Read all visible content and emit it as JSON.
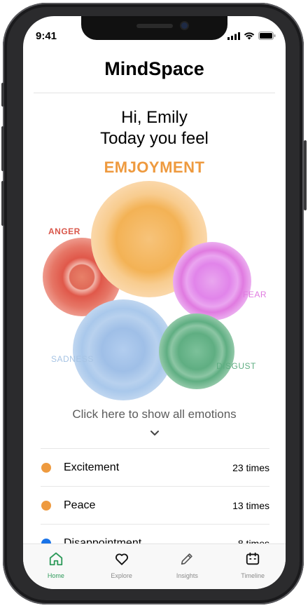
{
  "status": {
    "time": "9:41"
  },
  "app": {
    "title": "MindSpace"
  },
  "greeting": {
    "line1": "Hi, Emily",
    "line2": "Today you feel"
  },
  "today_emotion": "EMJOYMENT",
  "emotions": {
    "anger": {
      "label": "ANGER",
      "color": "#e0584a"
    },
    "fear": {
      "label": "FEAR",
      "color": "#e07ae0"
    },
    "sadness": {
      "label": "SADNESS",
      "color": "#9cc2e8"
    },
    "disgust": {
      "label": "DISGUST",
      "color": "#5fae82"
    },
    "enjoyment": {
      "color": "#f3b255"
    }
  },
  "show_all": "Click here to show all emotions",
  "list": [
    {
      "label": "Excitement",
      "count": "23 times",
      "color": "#ee9a3f"
    },
    {
      "label": "Peace",
      "count": "13 times",
      "color": "#ee9a3f"
    },
    {
      "label": "Disappointment",
      "count": "8 times",
      "color": "#1a73e8"
    }
  ],
  "tabs": [
    {
      "label": "Home",
      "icon": "home-icon",
      "active": true
    },
    {
      "label": "Explore",
      "icon": "heart-icon"
    },
    {
      "label": "Insights",
      "icon": "pencil-icon"
    },
    {
      "label": "Timeline",
      "icon": "calendar-icon"
    }
  ]
}
